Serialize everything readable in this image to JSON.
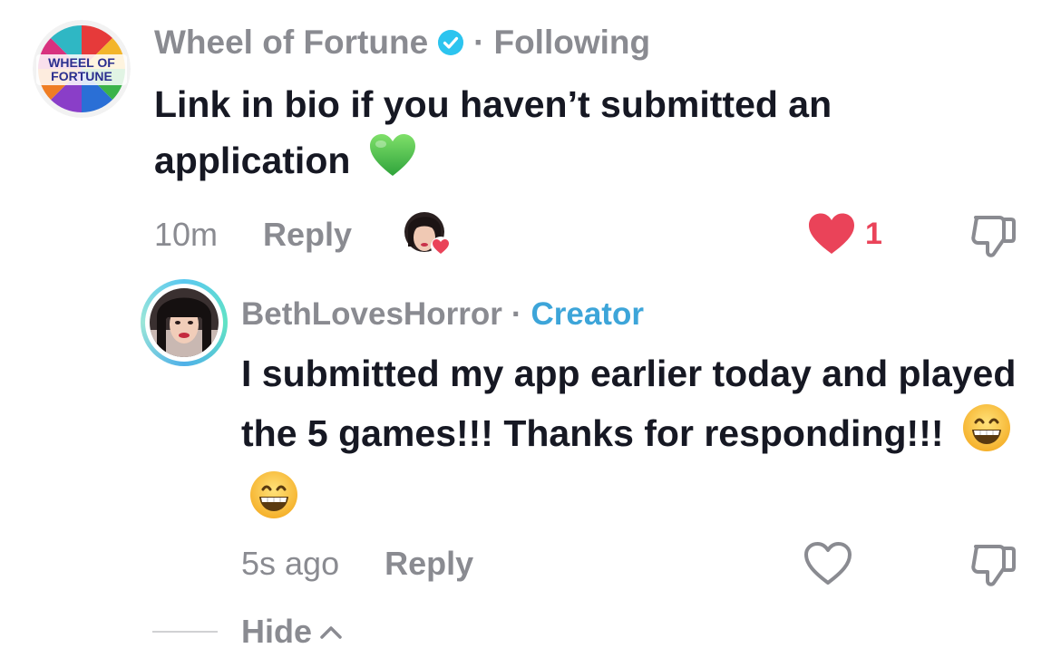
{
  "comment": {
    "username": "Wheel of Fortune",
    "verified_icon": "verified-check-icon",
    "separator": "·",
    "follow_status": "Following",
    "logo_line1": "WHEEL OF",
    "logo_line2": "FORTUNE",
    "text": "Link in bio if you haven’t submitted an application",
    "emoji": "green-heart-emoji",
    "time": "10m",
    "reply_label": "Reply",
    "like_count": "1",
    "liked_by_creator": true
  },
  "reply": {
    "username": "BethLovesHorror",
    "separator": "·",
    "role": "Creator",
    "text": "I submitted my app earlier today and played the 5 games!!! Thanks for responding!!!",
    "emojis": [
      "grinning-face-emoji",
      "grinning-face-emoji"
    ],
    "time": "5s ago",
    "reply_label": "Reply",
    "liked": false
  },
  "thread": {
    "hide_label": "Hide"
  },
  "colors": {
    "like_red": "#ea4359",
    "creator_blue": "#3da5d9",
    "muted_gray": "#8a8b91",
    "text_dark": "#161823"
  }
}
